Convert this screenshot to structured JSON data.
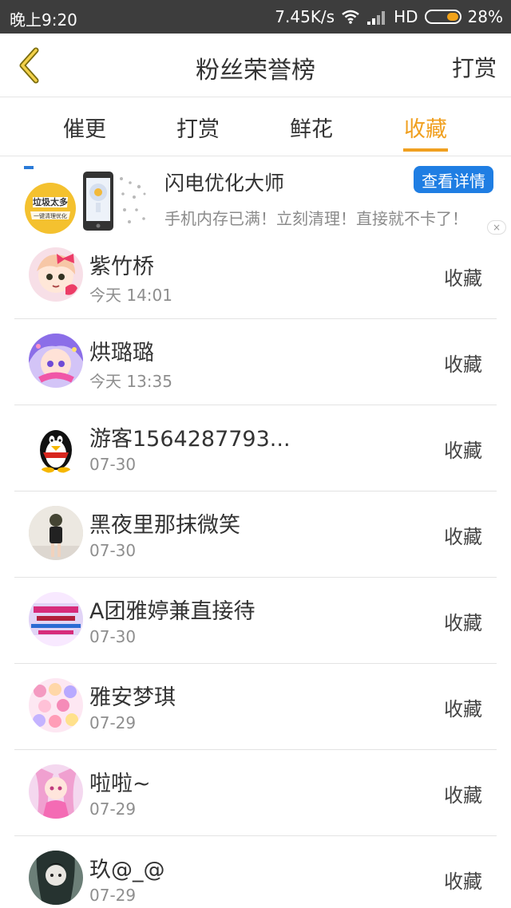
{
  "status_bar": {
    "time": "晚上9:20",
    "speed": "7.45K/s",
    "network": "HD",
    "battery": "28%",
    "battery_level": 0.28,
    "icons": [
      "wifi-icon",
      "signal-icon",
      "battery-icon"
    ]
  },
  "header": {
    "title": "粉丝荣誉榜",
    "back_icon": "chevron-left-icon",
    "action": "打赏"
  },
  "tabs": [
    {
      "label": "催更",
      "active": false
    },
    {
      "label": "打赏",
      "active": false
    },
    {
      "label": "鲜花",
      "active": false
    },
    {
      "label": "收藏",
      "active": true
    }
  ],
  "ad": {
    "image_label": "垃圾太多",
    "image_sublabel": "一键清理优化",
    "title": "闪电优化大师",
    "description": "手机内存已满！立刻清理！直接就不卡了！",
    "button": "查看详情",
    "close_icon": "close-icon"
  },
  "list": [
    {
      "name": "紫竹桥",
      "date": "今天 14:01",
      "action": "收藏",
      "avatar": "anime-avatar-pink"
    },
    {
      "name": "烘璐璐",
      "date": "今天 13:35",
      "action": "收藏",
      "avatar": "anime-avatar-purple"
    },
    {
      "name": "游客1564287793...",
      "date": "07-30",
      "action": "收藏",
      "avatar": "penguin-avatar"
    },
    {
      "name": "黑夜里那抹微笑",
      "date": "07-30",
      "action": "收藏",
      "avatar": "photo-avatar"
    },
    {
      "name": "A团雅婷兼直接待",
      "date": "07-30",
      "action": "收藏",
      "avatar": "text-avatar"
    },
    {
      "name": "雅安梦琪",
      "date": "07-29",
      "action": "收藏",
      "avatar": "collage-avatar"
    },
    {
      "name": "啦啦~",
      "date": "07-29",
      "action": "收藏",
      "avatar": "anime-avatar-rose"
    },
    {
      "name": "玖@_@",
      "date": "07-29",
      "action": "收藏",
      "avatar": "dark-avatar"
    }
  ],
  "colors": {
    "accent": "#f0a020",
    "status_bar": "#3d3d3d",
    "ad_button": "#1f7ee3",
    "text": "#333333",
    "muted": "#8e8e8e"
  }
}
